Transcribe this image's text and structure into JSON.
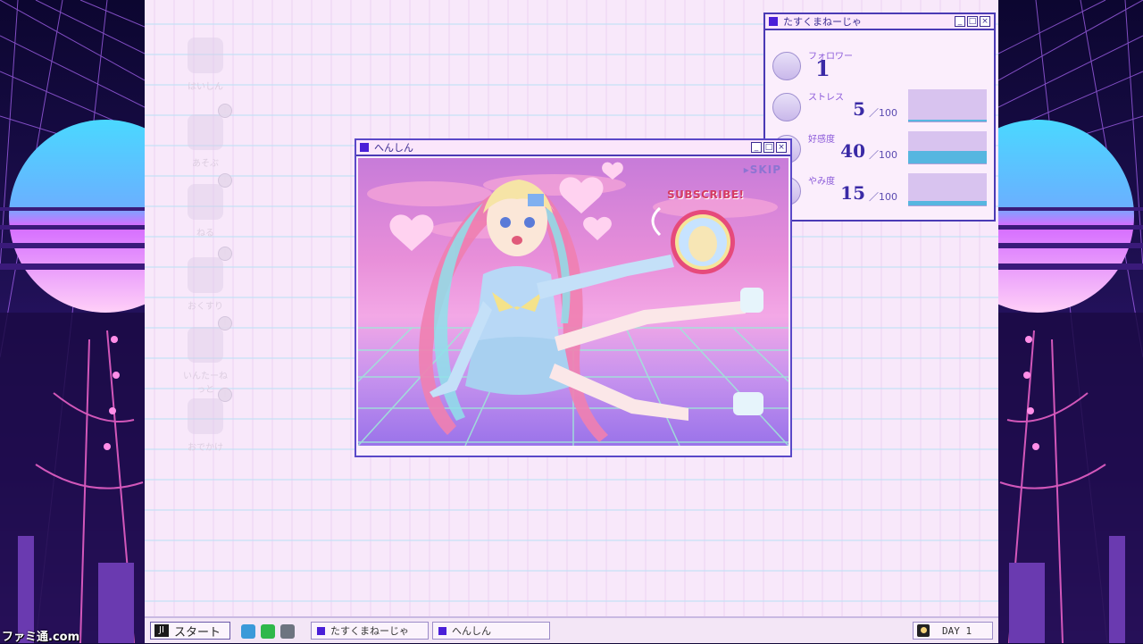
{
  "desktop": {
    "icons": [
      {
        "label": "はいしん",
        "icon": "stream-icon"
      },
      {
        "label": "あそぶ",
        "icon": "play-icon",
        "badge": "!"
      },
      {
        "label": "ねる",
        "icon": "sleep-icon",
        "badge": "!"
      },
      {
        "label": "おくすり",
        "icon": "medicine-icon",
        "badge": "!"
      },
      {
        "label": "いんたーねっと",
        "icon": "internet-icon",
        "badge": "!"
      },
      {
        "label": "おでかけ",
        "icon": "outing-icon",
        "badge": "!"
      }
    ]
  },
  "stats_window": {
    "title": "たすくまねーじゃ",
    "controls": [
      "_",
      "□",
      "×"
    ],
    "followers": {
      "label": "フォロワー",
      "value": "1"
    },
    "stats": [
      {
        "label": "ストレス",
        "value": "5",
        "max": "／100",
        "level": 0.05
      },
      {
        "label": "好感度",
        "value": "40",
        "max": "／100",
        "level": 0.4
      },
      {
        "label": "やみ度",
        "value": "15",
        "max": "／100",
        "level": 0.15
      }
    ]
  },
  "video_window": {
    "title": "へんしん",
    "controls": [
      "_",
      "□",
      "×"
    ],
    "skip": "▸SKIP",
    "subscribe": "SUBSCRIBE!"
  },
  "taskbar": {
    "start_label": "スタート",
    "start_logo": "JI",
    "quick_icons": [
      "twitter-icon",
      "chat-icon",
      "monitor-icon"
    ],
    "tasks": [
      {
        "label": "たすくまねーじゃ"
      },
      {
        "label": "へんしん"
      }
    ],
    "day": "DAY 1"
  },
  "watermark": "ファミ通.com",
  "colors": {
    "window_border": "#4a3ab5",
    "accent_square": "#4a1fd8",
    "bar_fill": "#56b6e0",
    "bar_bg": "#d8c3ef",
    "stat_value": "#3a2aa6",
    "subscribe": "#d43c63"
  }
}
